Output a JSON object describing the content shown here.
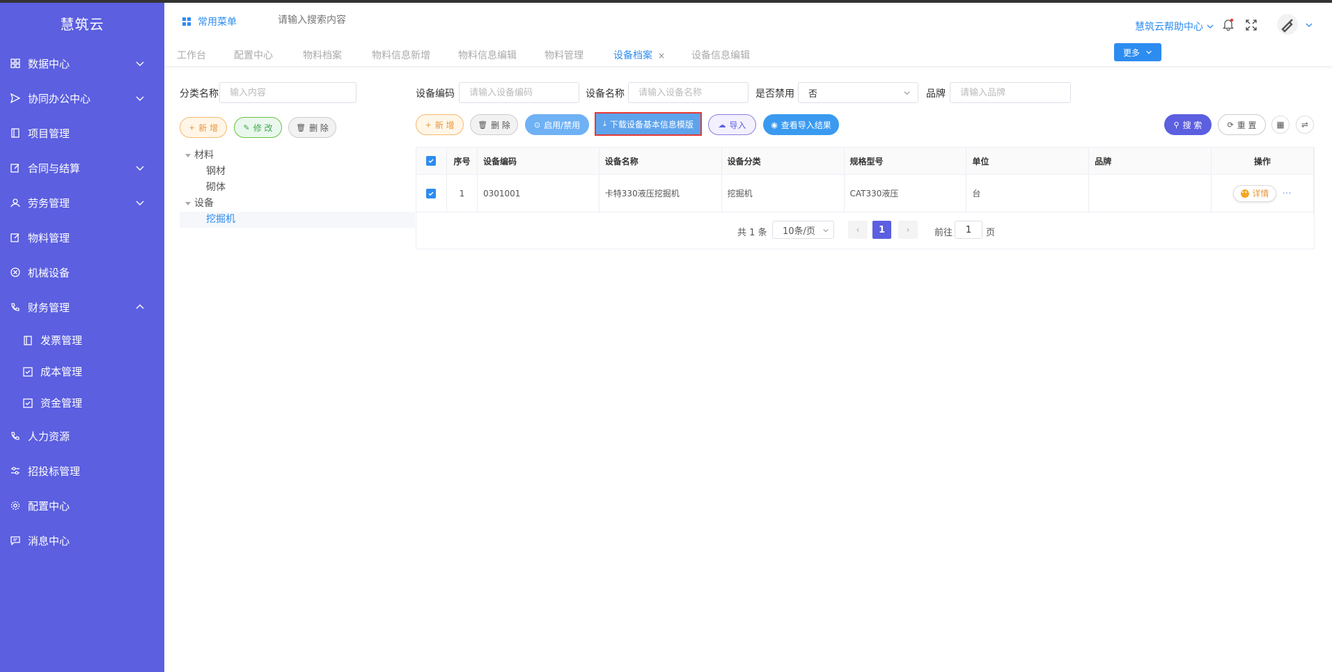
{
  "app": {
    "title": "慧筑云"
  },
  "colors": {
    "sidebar": "#5b5fe0",
    "primary": "#2d8cf0",
    "highlight": "#e53935"
  },
  "sidebar": {
    "items": [
      {
        "label": "数据中心",
        "icon": "grid-icon",
        "chevron": "down"
      },
      {
        "label": "协同办公中心",
        "icon": "send-icon",
        "chevron": "down"
      },
      {
        "label": "项目管理",
        "icon": "book-icon"
      },
      {
        "label": "合同与结算",
        "icon": "edit-icon",
        "chevron": "down"
      },
      {
        "label": "劳务管理",
        "icon": "user-icon",
        "chevron": "down"
      },
      {
        "label": "物料管理",
        "icon": "edit-icon"
      },
      {
        "label": "机械设备",
        "icon": "close-circle-icon"
      },
      {
        "label": "财务管理",
        "icon": "phone-icon",
        "chevron": "up"
      }
    ],
    "sub_items": [
      {
        "label": "发票管理",
        "icon": "book-icon"
      },
      {
        "label": "成本管理",
        "icon": "checkbox-icon"
      },
      {
        "label": "资金管理",
        "icon": "checkbox-icon"
      }
    ],
    "items_after": [
      {
        "label": "人力资源",
        "icon": "phone-icon"
      },
      {
        "label": "招投标管理",
        "icon": "sliders-icon"
      },
      {
        "label": "配置中心",
        "icon": "gear-icon"
      },
      {
        "label": "消息中心",
        "icon": "message-icon"
      }
    ]
  },
  "header": {
    "common_menu": "常用菜单",
    "search_placeholder": "请输入搜索内容",
    "help": "慧筑云帮助中心"
  },
  "tabs": [
    {
      "label": "工作台"
    },
    {
      "label": "配置中心"
    },
    {
      "label": "物料档案"
    },
    {
      "label": "物料信息新增"
    },
    {
      "label": "物料信息编辑"
    },
    {
      "label": "物料管理"
    },
    {
      "label": "设备档案",
      "active": true,
      "close": "×"
    },
    {
      "label": "设备信息编辑"
    }
  ],
  "more_button": "更多",
  "category": {
    "label": "分类名称",
    "placeholder": "输入内容",
    "buttons": {
      "add": "新 增",
      "edit": "修 改",
      "delete": "删 除"
    },
    "tree": [
      {
        "label": "材料",
        "level": 0,
        "expanded": true
      },
      {
        "label": "钢材",
        "level": 1
      },
      {
        "label": "砌体",
        "level": 1
      },
      {
        "label": "设备",
        "level": 0,
        "expanded": true
      },
      {
        "label": "挖掘机",
        "level": 1,
        "selected": true
      }
    ]
  },
  "filters": {
    "code_label": "设备编码",
    "code_placeholder": "请输入设备编码",
    "name_label": "设备名称",
    "name_placeholder": "请输入设备名称",
    "disabled_label": "是否禁用",
    "disabled_value": "否",
    "brand_label": "品牌",
    "brand_placeholder": "请输入品牌"
  },
  "toolbar": {
    "add": "新 增",
    "delete": "删 除",
    "toggle": "启用/禁用",
    "download": "下载设备基本信息模版",
    "import": "导入",
    "view_import": "查看导入结果",
    "search": "搜 索",
    "reset": "重 置"
  },
  "table": {
    "columns": [
      "序号",
      "设备编码",
      "设备名称",
      "设备分类",
      "规格型号",
      "单位",
      "品牌",
      "操作"
    ],
    "rows": [
      {
        "index": "1",
        "code": "0301001",
        "name": "卡特330液压挖掘机",
        "category": "挖掘机",
        "spec": "CAT330液压",
        "unit": "台",
        "brand": "",
        "action": "详情"
      }
    ]
  },
  "pagination": {
    "total": "共 1 条",
    "page_size": "10条/页",
    "current": "1",
    "goto_label": "前往",
    "goto_value": "1",
    "page_unit": "页"
  }
}
